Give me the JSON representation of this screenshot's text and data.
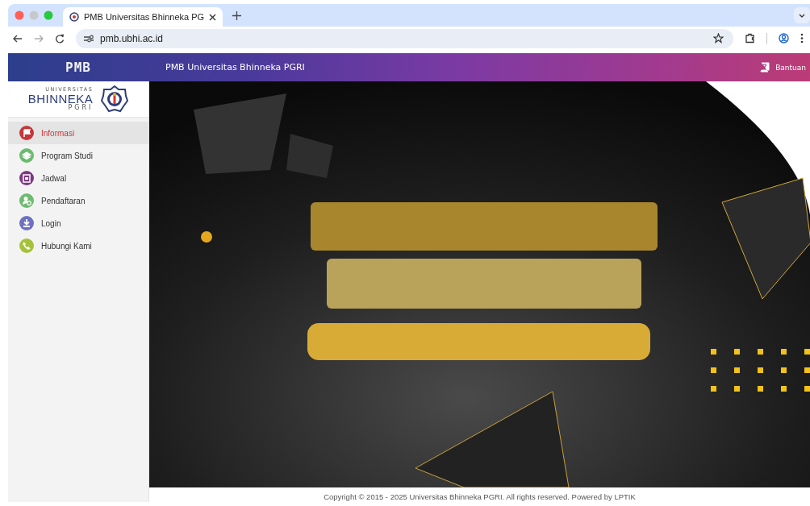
{
  "browser": {
    "tabs": [
      {
        "title": "PMB Universitas Bhinneka PG",
        "selected": true
      }
    ],
    "address": "pmb.ubhi.ac.id"
  },
  "header": {
    "logo": "PMB",
    "title": "PMB Universitas Bhinneka PGRI",
    "help": "Bantuan"
  },
  "sidebar": {
    "logo": {
      "top": "UNIVERSITAS",
      "name": "BHINNEKA",
      "sub": "PGRI"
    },
    "items": [
      {
        "label": "Informasi",
        "selected": true,
        "color": "#c6363a"
      },
      {
        "label": "Program Studi",
        "selected": false,
        "color": "#6cbb6e"
      },
      {
        "label": "Jadwal",
        "selected": false,
        "color": "#7c3a80"
      },
      {
        "label": "Pendaftaran",
        "selected": false,
        "color": "#6cbb6e"
      },
      {
        "label": "Login",
        "selected": false,
        "color": "#6e70c0"
      },
      {
        "label": "Hubungi Kami",
        "selected": false,
        "color": "#a5c23a"
      }
    ]
  },
  "footer": "Copyright © 2015 - 2025 Universitas Bhinneka PGRI. All rights reserved. Powered by LPTIK"
}
